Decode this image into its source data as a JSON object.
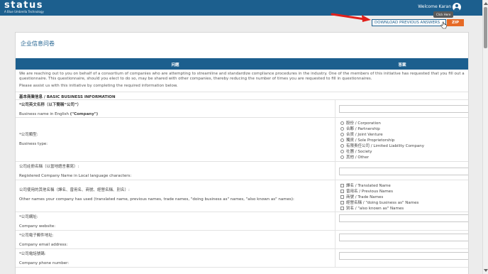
{
  "header": {
    "logo_text": "status",
    "logo_tagline": "A Blue Umbrella Technology",
    "welcome_text": "Welcome Karan"
  },
  "toolbar": {
    "tooltip": "Click Here",
    "download_label": "DOWNLOAD PREVIOUS ANSWERS",
    "zip_label": "ZIP"
  },
  "form": {
    "title": "企业信息问卷",
    "col_question": "问题",
    "col_answer": "答案",
    "intro_para1": "We are reaching out to you on behalf of a consortium of companies who are attempting to streamline and standardize compliance procedures in the industry. One of the members of this initiative has requested that you fill out a questionnaire. This questionnaire, should you elect to do so, may be shared with other companies, thereby reducing the number of times you are requested to fill in questionnaires.",
    "intro_para2": "Please assist us with this initiative by completing the required information below.",
    "section_basic": "基本商業信息 / BASIC BUSINESS INFORMATION",
    "q_name_zh": "*公司英文名称（以下簡稱“公司”）",
    "q_name_en_prefix": "Business name in English ",
    "q_name_en_bold": "(\"Company\")",
    "q_type_zh": "*公司類型:",
    "q_type_en": "Business type:",
    "type_options": [
      "股份 / Corporation",
      "合夥 / Partnership",
      "合資 / Joint Venture",
      "獨資 / Sole Proprietorship",
      "有限责任公司 / Limited Liability Company",
      "社團 / Society",
      "其他 / Other"
    ],
    "q_local_zh": "公司註冊名稱（以當地語言書寫）:",
    "q_local_en": "Registered Company Name in Local language characters:",
    "q_other_zh": "公司使用的其他名稱（譯名、曾用名、商號、經營名稱、別名）:",
    "q_other_en": "Other names your company has used (translated name, previous names, trade names, \"doing business as\" names, \"also known as\" names):",
    "other_options": [
      "譯名 / Translated Name",
      "曾用名 / Previous Names",
      "商號 / Trade Names",
      "經營名稱 / \"doing business as\" Names",
      "別名 / \"also known as\" Names"
    ],
    "q_website_zh": "*公司網址:",
    "q_website_en": "Company website:",
    "q_email_zh": "*公司電子郵件地址:",
    "q_email_en": "Company email address:",
    "q_phone_zh": "*公司電話號碼:",
    "q_phone_en": "Company phone number:"
  },
  "colors": {
    "brand_blue": "#1c5f8e",
    "accent_orange": "#e66a26",
    "arrow_red": "#e0201b"
  }
}
